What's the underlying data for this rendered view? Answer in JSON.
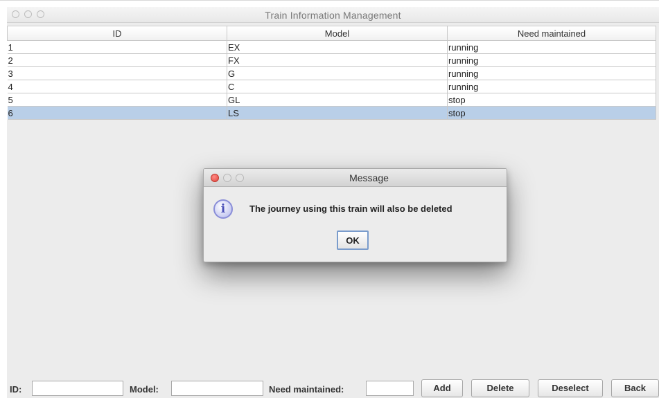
{
  "window": {
    "title": "Train Information Management"
  },
  "table": {
    "columns": [
      "ID",
      "Model",
      "Need maintained"
    ],
    "rows": [
      {
        "id": "1",
        "model": "EX",
        "need": "running"
      },
      {
        "id": "2",
        "model": "FX",
        "need": "running"
      },
      {
        "id": "3",
        "model": "G",
        "need": "running"
      },
      {
        "id": "4",
        "model": "C",
        "need": "running"
      },
      {
        "id": "5",
        "model": "GL",
        "need": "stop"
      },
      {
        "id": "6",
        "model": "LS",
        "need": "stop"
      }
    ],
    "selected_row": 6
  },
  "form": {
    "id_label": "ID:",
    "id_value": "",
    "model_label": "Model:",
    "model_value": "",
    "need_label": "Need maintained:",
    "need_value": "",
    "add_label": "Add",
    "delete_label": "Delete",
    "deselect_label": "Deselect",
    "back_label": "Back"
  },
  "dialog": {
    "title": "Message",
    "message": "The journey using this train will also be deleted",
    "ok_label": "OK",
    "icon": "info-icon"
  },
  "colors": {
    "selected_row": "#b9cfe8",
    "dialog_close": "#e0443e",
    "ok_border": "#7a9ccc"
  }
}
